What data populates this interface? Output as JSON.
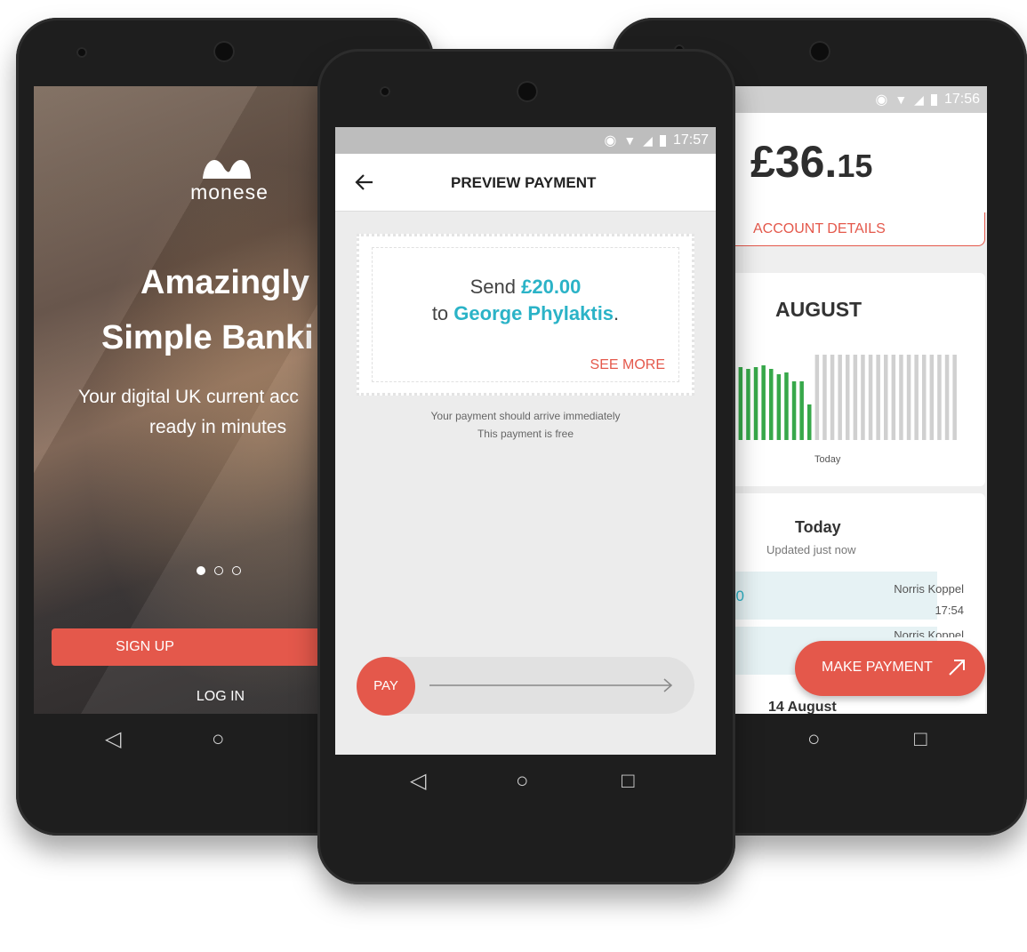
{
  "left_phone": {
    "status_time": "",
    "brand": "monese",
    "headline_line1": "Amazingly",
    "headline_line2": "Simple Banki",
    "subtitle_line1": "Your digital UK current acc",
    "subtitle_line2": "ready in minutes",
    "signup_label": "SIGN UP",
    "login_label": "LOG IN",
    "page_dots": {
      "count": 3,
      "active": 1
    }
  },
  "center_phone": {
    "status_time": "17:57",
    "header_title": "PREVIEW PAYMENT",
    "send_word": "Send",
    "amount": "£20.00",
    "to_word": "to",
    "recipient": "George Phylaktis",
    "period": ".",
    "see_more": "SEE MORE",
    "note_line1": "Your payment should arrive immediately",
    "note_line2": "This payment is free",
    "pay_label": "PAY"
  },
  "right_phone": {
    "status_time": "17:56",
    "balance_main": "£36.",
    "balance_pence": "15",
    "account_details": "ACCOUNT DETAILS",
    "month": "AUGUST",
    "today_marker": "Today",
    "section_title": "Today",
    "section_sub": "Updated just now",
    "tx1_amount_fragment": "00",
    "tx1_name": "Norris Koppel",
    "tx1_time": "17:54",
    "tx2_name": "Norris Koppel",
    "next_section": "14 August",
    "make_payment": "MAKE PAYMENT"
  },
  "colors": {
    "accent_red": "#e4584b",
    "teal": "#2bb3c7",
    "bar_green": "#37a84a",
    "bar_grey": "#d0d0d0"
  },
  "chart_data": {
    "type": "bar",
    "title": "AUGUST",
    "bars_green_count": 11,
    "bars_grey_count": 19,
    "today_marker_after_bar": 11
  }
}
